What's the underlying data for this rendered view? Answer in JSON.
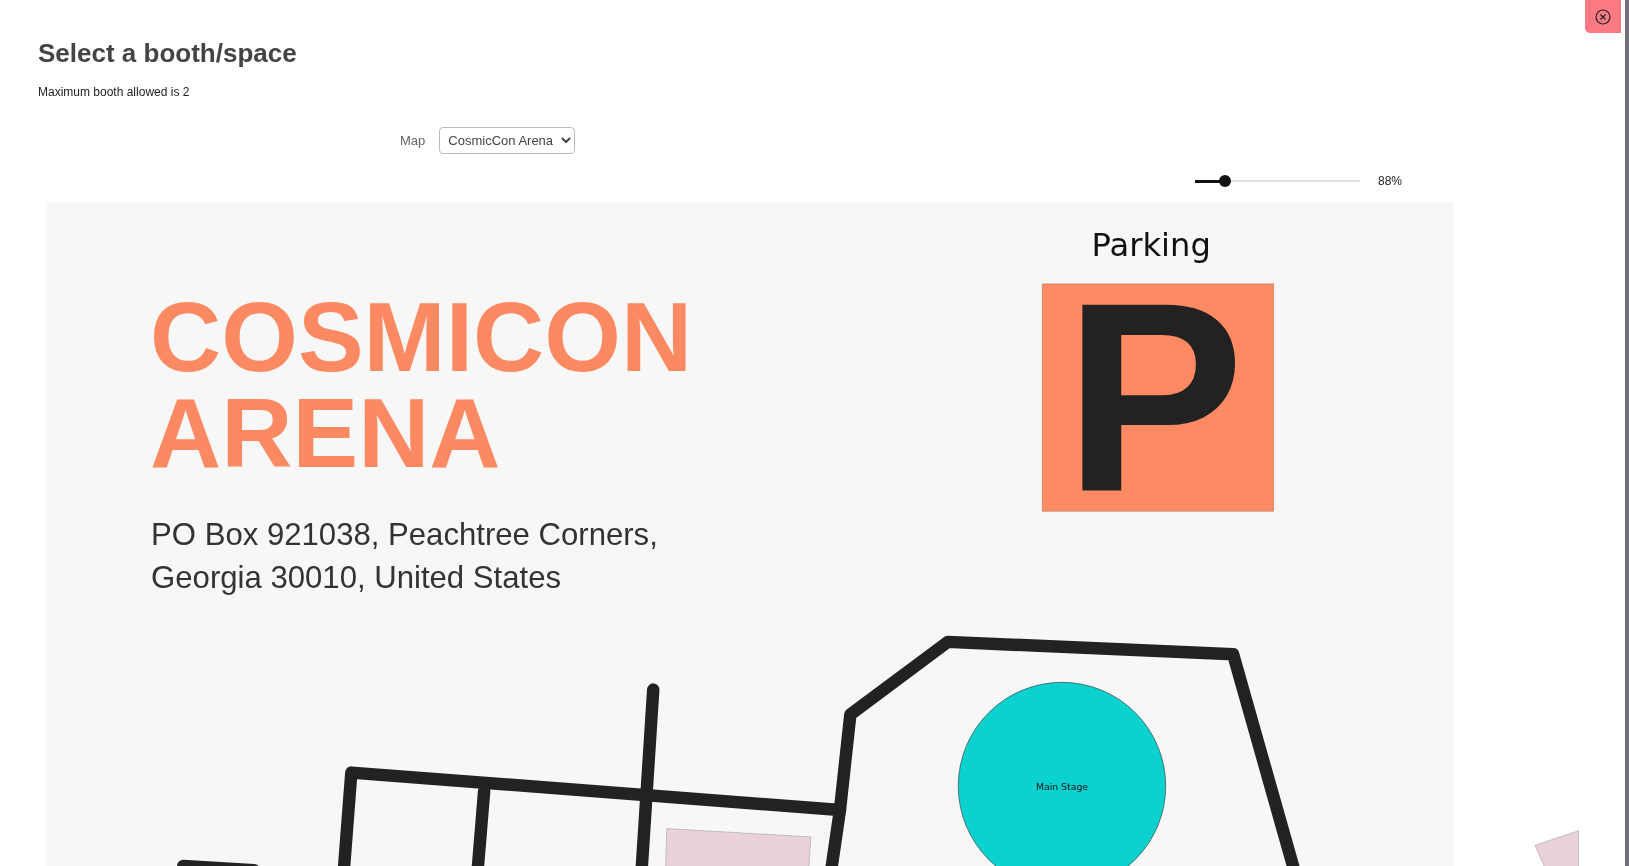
{
  "title": "Select a booth/space",
  "subtitle": "Maximum booth allowed is 2",
  "map_select": {
    "label": "Map",
    "value": "CosmicCon Arena"
  },
  "zoom": {
    "level": 0.18,
    "reading": "88%"
  },
  "map": {
    "venue_name": [
      "COSMICON",
      "ARENA"
    ],
    "address": [
      "PO Box 921038, Peachtree Corners,",
      "Georgia 30010, United States"
    ],
    "parking_label": "Parking",
    "parking_sign": "P",
    "stage_label": "Main Stage"
  }
}
